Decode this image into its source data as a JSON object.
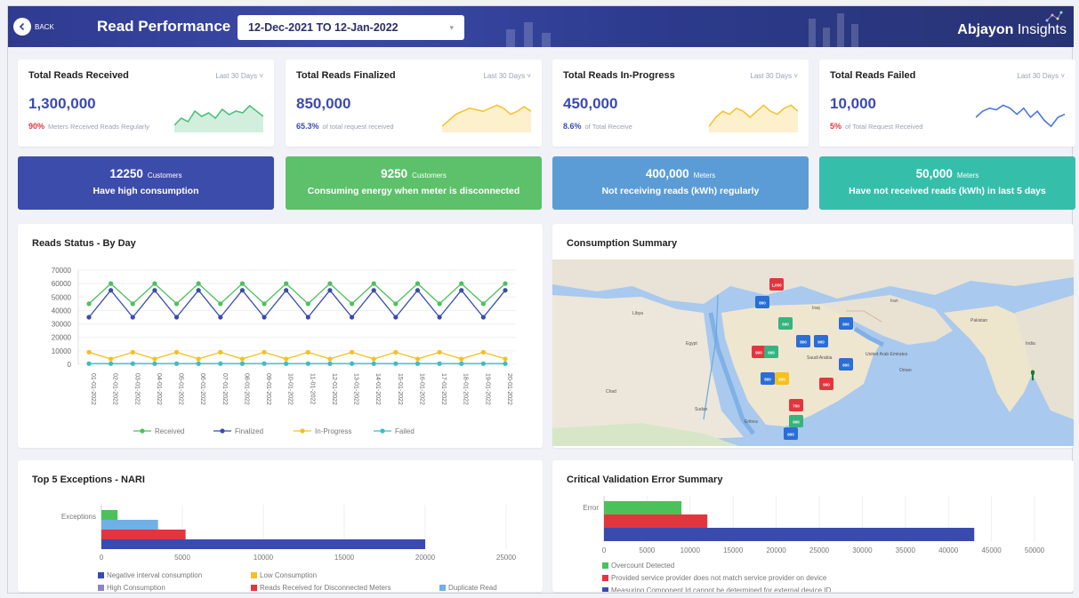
{
  "header": {
    "back_label": "BACK",
    "title": "Read Performance",
    "date_range": "12-Dec-2021 TO 12-Jan-2022",
    "brand_bold": "Abjayon",
    "brand_rest": " Insights"
  },
  "kpis": [
    {
      "title": "Total Reads Received",
      "period": "Last 30 Days",
      "value": "1,300,000",
      "pct": "90%",
      "pct_color": "#e2363f",
      "sub": "Meters Received Reads Regularly",
      "spark_color": "#4cc17c",
      "spark_type": "area",
      "spark": [
        22,
        26,
        24,
        30,
        27,
        29,
        26,
        31,
        28,
        30,
        29,
        33,
        30,
        27
      ]
    },
    {
      "title": "Total Reads Finalized",
      "period": "Last 30 Days",
      "value": "850,000",
      "pct": "65.3%",
      "pct_color": "#3b4bb0",
      "sub": "of total request received",
      "spark_color": "#f6c432",
      "spark_type": "area",
      "spark": [
        10,
        14,
        18,
        20,
        22,
        21,
        20,
        22,
        24,
        22,
        18,
        20,
        23,
        20
      ]
    },
    {
      "title": "Total Reads In-Progress",
      "period": "Last 30 Days",
      "value": "450,000",
      "pct": "8.6%",
      "pct_color": "#3b4bb0",
      "sub": "of Total Receive",
      "spark_color": "#f6c432",
      "spark_type": "area",
      "spark": [
        8,
        14,
        18,
        16,
        20,
        18,
        14,
        18,
        22,
        18,
        16,
        20,
        22,
        18
      ]
    },
    {
      "title": "Total Reads Failed",
      "period": "Last 30 Days",
      "value": "10,000",
      "pct": "5%",
      "pct_color": "#e2363f",
      "sub": "of Total Request Received",
      "spark_color": "#4a78d6",
      "spark_type": "line",
      "spark": [
        20,
        24,
        26,
        25,
        28,
        26,
        22,
        26,
        20,
        24,
        18,
        14,
        20,
        22
      ]
    }
  ],
  "banners": [
    {
      "value": "12250",
      "unit": "Customers",
      "text": "Have high consumption",
      "color": "#3c4cab"
    },
    {
      "value": "9250",
      "unit": "Customers",
      "text": "Consuming energy when meter is disconnected",
      "color": "#5cc16a"
    },
    {
      "value": "400,000",
      "unit": "Meters",
      "text": "Not receiving reads (kWh) regularly",
      "color": "#5b9cd6"
    },
    {
      "value": "50,000",
      "unit": "Meters",
      "text": "Have not received reads (kWh) in last 5 days",
      "color": "#35bfab"
    }
  ],
  "reads_status": {
    "title": "Reads Status - By Day",
    "chart_data": {
      "type": "line",
      "x": [
        "01-01-2022",
        "02-01-2022",
        "03-01-2022",
        "04-01-2022",
        "05-01-2022",
        "06-01-2022",
        "07-01-2022",
        "08-01-2022",
        "09-01-2022",
        "10-01-2022",
        "11-01-2022",
        "12-01-2022",
        "13-01-2022",
        "14-01-2022",
        "15-01-2022",
        "16-01-2022",
        "17-01-2022",
        "18-01-2022",
        "19-01-2022",
        "20-01-2022"
      ],
      "yticks": [
        0,
        10000,
        20000,
        30000,
        40000,
        50000,
        60000,
        70000
      ],
      "ylim": [
        0,
        70000
      ],
      "series": [
        {
          "name": "Received",
          "color": "#4cc15a",
          "values": [
            45000,
            60000,
            45000,
            60000,
            45000,
            60000,
            45000,
            60000,
            45000,
            60000,
            45000,
            60000,
            45000,
            60000,
            45000,
            60000,
            45000,
            60000,
            45000,
            60000
          ]
        },
        {
          "name": "Finalized",
          "color": "#3a4bb0",
          "values": [
            35000,
            55000,
            35000,
            55000,
            35000,
            55000,
            35000,
            55000,
            35000,
            55000,
            35000,
            55000,
            35000,
            55000,
            35000,
            55000,
            35000,
            55000,
            35000,
            55000
          ]
        },
        {
          "name": "In-Progress",
          "color": "#f6c020",
          "values": [
            9000,
            4000,
            9000,
            4000,
            9000,
            4000,
            9000,
            4000,
            9000,
            4000,
            9000,
            4000,
            9000,
            4000,
            9000,
            4000,
            9000,
            4000,
            9000,
            4000
          ]
        },
        {
          "name": "Failed",
          "color": "#37c0c0",
          "values": [
            500,
            500,
            500,
            500,
            500,
            500,
            500,
            500,
            500,
            500,
            500,
            500,
            500,
            500,
            500,
            500,
            500,
            500,
            500,
            500
          ]
        }
      ]
    }
  },
  "consumption": {
    "title": "Consumption Summary",
    "markers": [
      {
        "label": "1,000",
        "color": "#e2363f"
      },
      {
        "label": "800",
        "color": "#2a6ed6"
      },
      {
        "label": "600",
        "color": "#37b37e"
      },
      {
        "label": "800",
        "color": "#2a6ed6"
      },
      {
        "label": "900",
        "color": "#2a6ed6"
      },
      {
        "label": "800",
        "color": "#2a6ed6"
      },
      {
        "label": "900",
        "color": "#e2363f"
      },
      {
        "label": "600",
        "color": "#37b37e"
      },
      {
        "label": "800",
        "color": "#2a6ed6"
      },
      {
        "label": "900",
        "color": "#f6c020"
      },
      {
        "label": "800",
        "color": "#2a6ed6"
      },
      {
        "label": "900",
        "color": "#e2363f"
      },
      {
        "label": "700",
        "color": "#e2363f"
      },
      {
        "label": "900",
        "color": "#37b37e"
      },
      {
        "label": "600",
        "color": "#2a6ed6"
      }
    ],
    "places": [
      "Libya",
      "Egypt",
      "Sudan",
      "Chad",
      "Saudi Arabia",
      "United Arab Emirates",
      "Oman",
      "Eritrea",
      "Iran",
      "Iraq",
      "India",
      "Pakistan"
    ]
  },
  "exceptions": {
    "title": "Top 5 Exceptions - NARI",
    "chart_data": {
      "type": "bar",
      "orientation": "horizontal",
      "category": "Exceptions",
      "xlim": [
        0,
        25000
      ],
      "xticks": [
        0,
        5000,
        10000,
        15000,
        20000,
        25000
      ],
      "series": [
        {
          "name": "Negative interval consumption",
          "color": "#3a4bb0",
          "value": 20000
        },
        {
          "name": "Low Consumption",
          "color": "#f6c020",
          "value": 0
        },
        {
          "name": "High Consumption",
          "color": "#8a86c6",
          "value": 0
        },
        {
          "name": "Reads Received for Disconnected Meters",
          "color": "#e2363f",
          "value": 5200
        },
        {
          "name": "Duplicate Read",
          "color": "#6fb0e6",
          "value": 3500
        },
        {
          "name": "",
          "color": "#4cc15a",
          "value": 1000
        }
      ]
    }
  },
  "validation": {
    "title": "Critical Validation Error Summary",
    "chart_data": {
      "type": "bar",
      "orientation": "horizontal",
      "category": "Error",
      "xlim": [
        0,
        50000
      ],
      "xticks": [
        0,
        5000,
        10000,
        15000,
        20000,
        25000,
        30000,
        35000,
        40000,
        45000,
        50000
      ],
      "series": [
        {
          "name": "Overcount Detected",
          "color": "#4cc15a",
          "value": 9000
        },
        {
          "name": "Provided service provider does not match service provider on device",
          "color": "#e2363f",
          "value": 12000
        },
        {
          "name": "Measuring Component Id cannot be determined for external device ID",
          "color": "#3a4bb0",
          "value": 43000
        }
      ]
    }
  }
}
